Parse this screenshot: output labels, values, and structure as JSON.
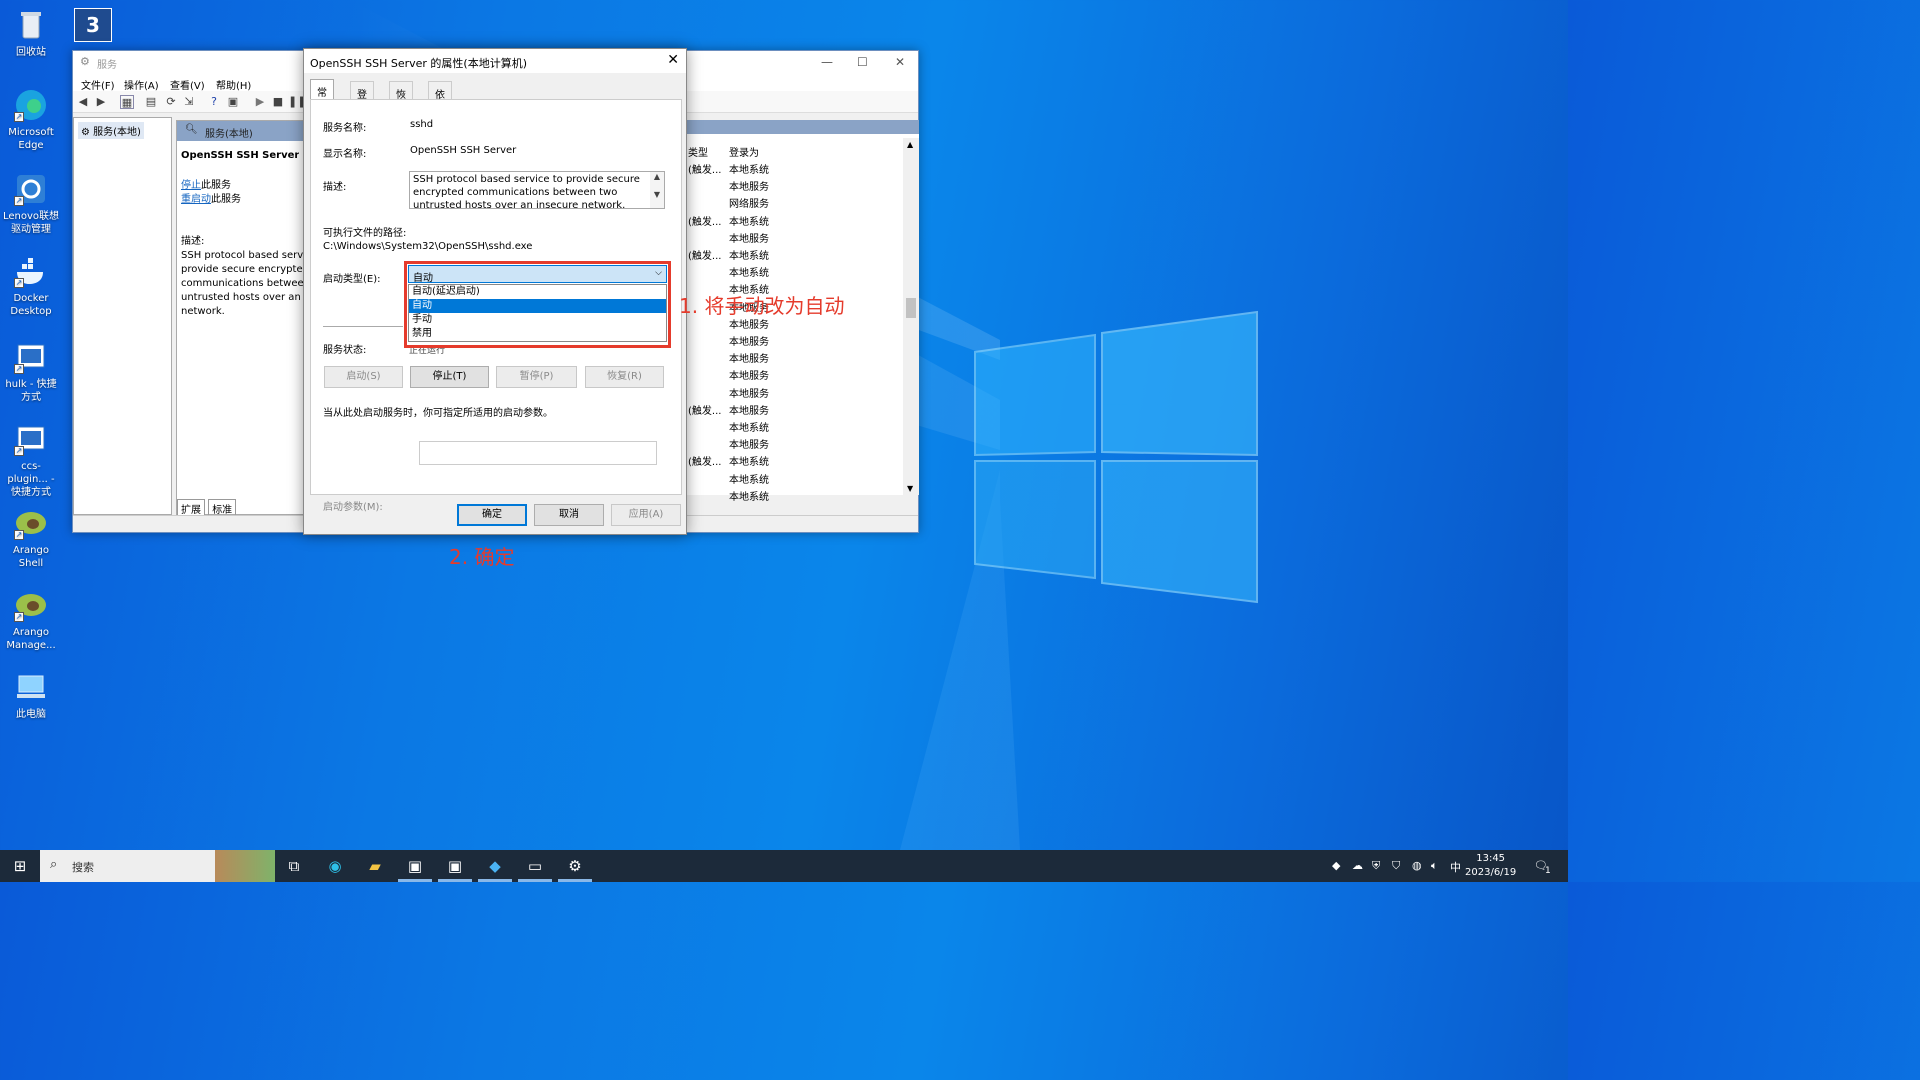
{
  "desktop": {
    "icons": [
      {
        "label": "回收站"
      },
      {
        "label": "Microsoft Edge"
      },
      {
        "label": "Lenovo联想驱动管理"
      },
      {
        "label": "Docker Desktop"
      },
      {
        "label": "hulk - 快捷方式"
      },
      {
        "label": "ccs-plugin... - 快捷方式"
      },
      {
        "label": "Arango Shell"
      },
      {
        "label": "Arango Manage..."
      },
      {
        "label": "此电脑"
      }
    ]
  },
  "services_window": {
    "title": "服务",
    "menu": [
      "文件(F)",
      "操作(A)",
      "查看(V)",
      "帮助(H)"
    ],
    "tree_item": "服务(本地)",
    "header": "服务(本地)",
    "service_name": "OpenSSH SSH Server",
    "stop_link": "停止",
    "stop_suffix": "此服务",
    "restart_link": "重启动",
    "restart_suffix": "此服务",
    "desc_label": "描述:",
    "desc_lines": [
      "SSH protocol based servi",
      "provide secure encrypted",
      "communications between",
      "untrusted hosts over an i",
      "network."
    ],
    "tabs": [
      "扩展",
      "标准"
    ],
    "columns": [
      "类型",
      "登录为"
    ],
    "rows": [
      {
        "type": "(触发...",
        "logon": "本地系统"
      },
      {
        "type": "",
        "logon": "本地服务"
      },
      {
        "type": "",
        "logon": "网络服务"
      },
      {
        "type": "(触发...",
        "logon": "本地系统"
      },
      {
        "type": "",
        "logon": "本地服务"
      },
      {
        "type": "(触发...",
        "logon": "本地系统"
      },
      {
        "type": "",
        "logon": "本地系统"
      },
      {
        "type": "",
        "logon": "本地系统"
      },
      {
        "type": "",
        "logon": "本地服务"
      },
      {
        "type": "",
        "logon": "本地服务"
      },
      {
        "type": "",
        "logon": "本地服务"
      },
      {
        "type": "",
        "logon": "本地服务"
      },
      {
        "type": "",
        "logon": "本地服务"
      },
      {
        "type": "",
        "logon": "本地服务"
      },
      {
        "type": "(触发...",
        "logon": "本地服务"
      },
      {
        "type": "",
        "logon": "本地系统"
      },
      {
        "type": "",
        "logon": "本地服务"
      },
      {
        "type": "(触发...",
        "logon": "本地系统"
      },
      {
        "type": "",
        "logon": "本地系统"
      },
      {
        "type": "",
        "logon": "本地系统"
      }
    ]
  },
  "dialog": {
    "title": "OpenSSH SSH Server 的属性(本地计算机)",
    "tabs": [
      "常规",
      "登录",
      "恢复",
      "依存关系"
    ],
    "service_name_label": "服务名称:",
    "service_name": "sshd",
    "display_name_label": "显示名称:",
    "display_name": "OpenSSH SSH Server",
    "description_label": "描述:",
    "description": "SSH protocol based service to provide secure encrypted communications between two untrusted hosts over an insecure network.",
    "path_label": "可执行文件的路径:",
    "path": "C:\\Windows\\System32\\OpenSSH\\sshd.exe",
    "startup_label": "启动类型(E):",
    "startup_value": "自动",
    "startup_options": [
      "自动(延迟启动)",
      "自动",
      "手动",
      "禁用"
    ],
    "selected_option": "自动",
    "status_label": "服务状态:",
    "status_value": "正在运行",
    "buttons": {
      "start": "启动(S)",
      "stop": "停止(T)",
      "pause": "暂停(P)",
      "resume": "恢复(R)"
    },
    "hint": "当从此处启动服务时，你可指定所适用的启动参数。",
    "param_label": "启动参数(M):",
    "param_value": "",
    "ok": "确定",
    "cancel": "取消",
    "apply": "应用(A)"
  },
  "annotations": {
    "step1": "1. 将手动改为自动",
    "step2": "2. 确定",
    "color": "#e53b2c"
  },
  "taskbar": {
    "search_placeholder": "搜索",
    "ime": "中",
    "time": "13:45",
    "date": "2023/6/19",
    "notification_count": "1"
  }
}
